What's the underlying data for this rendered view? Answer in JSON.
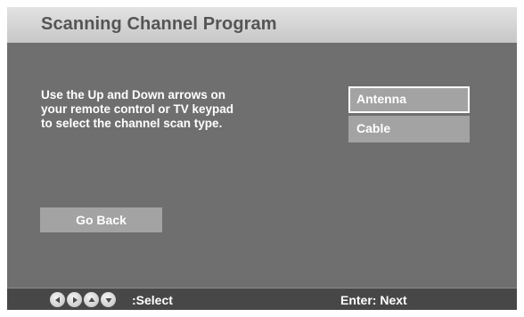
{
  "header": {
    "title": "Scanning Channel Program"
  },
  "instructions": {
    "line1": "Use the Up and Down arrows on",
    "line2": "your remote control or TV keypad",
    "line3": "to select the channel scan type."
  },
  "scan_options": [
    {
      "label": "Antenna",
      "selected": true
    },
    {
      "label": "Cable",
      "selected": false
    }
  ],
  "buttons": {
    "go_back": "Go Back"
  },
  "footer": {
    "nav_icons": [
      "left-arrow-icon",
      "right-arrow-icon",
      "up-arrow-icon",
      "down-arrow-icon"
    ],
    "select_hint": ":Select",
    "enter_hint": "Enter: Next"
  },
  "colors": {
    "background": "#6f6f6f",
    "title_bar": "#d6d6d6",
    "button": "#a3a3a3",
    "footer": "#474747",
    "text": "#ffffff"
  }
}
